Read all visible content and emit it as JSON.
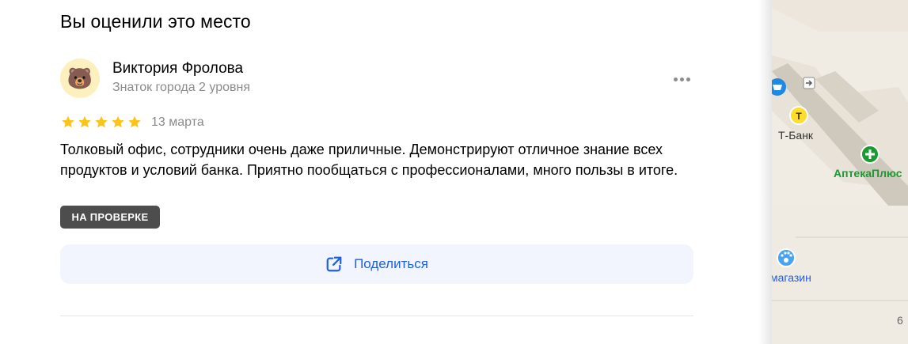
{
  "section": {
    "title": "Вы оценили это место"
  },
  "review": {
    "author_name": "Виктория Фролова",
    "author_level": "Знаток города 2 уровня",
    "avatar_emoji": "🐻",
    "rating": 5,
    "rating_max": 5,
    "date": "13 марта",
    "text": "Толковый офис, сотрудники очень даже приличные. Демонстрируют отличное знание всех продуктов и условий банка. Приятно пообщаться с профессионалами, много пользы в итоге.",
    "status_badge": "НА ПРОВЕРКЕ"
  },
  "actions": {
    "more_icon": "more-horizontal-icon",
    "share_label": "Поделиться",
    "share_icon": "share-external-icon"
  },
  "map": {
    "labels": {
      "tbank": "Т-Банк",
      "apteka": "АптекаПлюс",
      "shop": "магазин",
      "house_number": "6"
    }
  },
  "colors": {
    "star": "#fcc419",
    "badge_bg": "#4d4d4d",
    "share_text": "#1e5fe6",
    "share_bg": "#f2f5fd",
    "secondary_text": "#8b8b8b",
    "apteka_green": "#1a9a30",
    "tbank_yellow": "#ffdd2d"
  }
}
